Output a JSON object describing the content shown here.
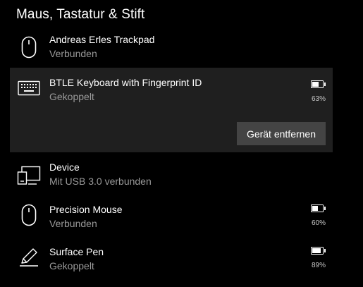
{
  "section": {
    "title": "Maus, Tastatur & Stift"
  },
  "devices": [
    {
      "name": "Andreas Erles Trackpad",
      "status": "Verbunden",
      "icon": "mouse-icon"
    },
    {
      "name": "BTLE Keyboard with Fingerprint ID",
      "status": "Gekoppelt",
      "icon": "keyboard-icon",
      "battery": {
        "level": 0.63,
        "label": "63%"
      },
      "selected": true,
      "action_label": "Gerät entfernen"
    },
    {
      "name": "Device",
      "status": "Mit USB 3.0 verbunden",
      "icon": "device-icon"
    },
    {
      "name": "Precision Mouse",
      "status": "Verbunden",
      "icon": "mouse-icon",
      "battery": {
        "level": 0.6,
        "label": "60%"
      }
    },
    {
      "name": "Surface Pen",
      "status": "Gekoppelt",
      "icon": "pen-icon",
      "battery": {
        "level": 0.89,
        "label": "89%"
      }
    }
  ],
  "colors": {
    "background": "#000000",
    "selected_background": "#1f1f1f",
    "button_background": "#444444",
    "secondary_text": "#9a9a9a"
  }
}
